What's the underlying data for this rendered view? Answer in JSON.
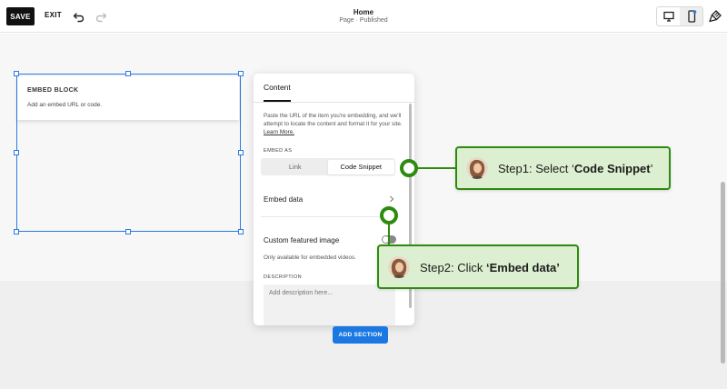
{
  "toolbar": {
    "save_label": "SAVE",
    "exit_label": "EXIT",
    "page_title": "Home",
    "page_status": "Page · Published",
    "undo_icon": "undo-icon",
    "redo_icon": "redo-icon",
    "desktop_icon": "desktop-icon",
    "mobile_icon": "mobile-icon",
    "style_icon": "paintbrush-icon"
  },
  "embed_block": {
    "title": "EMBED BLOCK",
    "description": "Add an embed URL or code."
  },
  "panel": {
    "tab": "Content",
    "help_text": "Paste the URL of the item you're embedding, and we'll attempt to locate the content and format it for your site.",
    "learn_more": "Learn More.",
    "embed_as_label": "EMBED AS",
    "embed_as_options": [
      "Link",
      "Code Snippet"
    ],
    "embed_as_selected": "Code Snippet",
    "embed_data_label": "Embed data",
    "custom_featured_image_label": "Custom featured image",
    "custom_featured_image_on": false,
    "custom_featured_image_note": "Only available for embedded videos.",
    "description_label": "DESCRIPTION",
    "description_placeholder": "Add description here..."
  },
  "add_section_label": "ADD SECTION",
  "callouts": {
    "step1_prefix": "Step1: Select ‘",
    "step1_bold": "Code Snippet",
    "step1_suffix": "’",
    "step2_prefix": "Step2: Click ",
    "step2_bold": "‘Embed data’",
    "step2_suffix": ""
  },
  "colors": {
    "accent": "#2a7be4",
    "add_section": "#1b78e2",
    "callout_border": "#2e8b0e",
    "callout_fill": "#dcefd0"
  }
}
